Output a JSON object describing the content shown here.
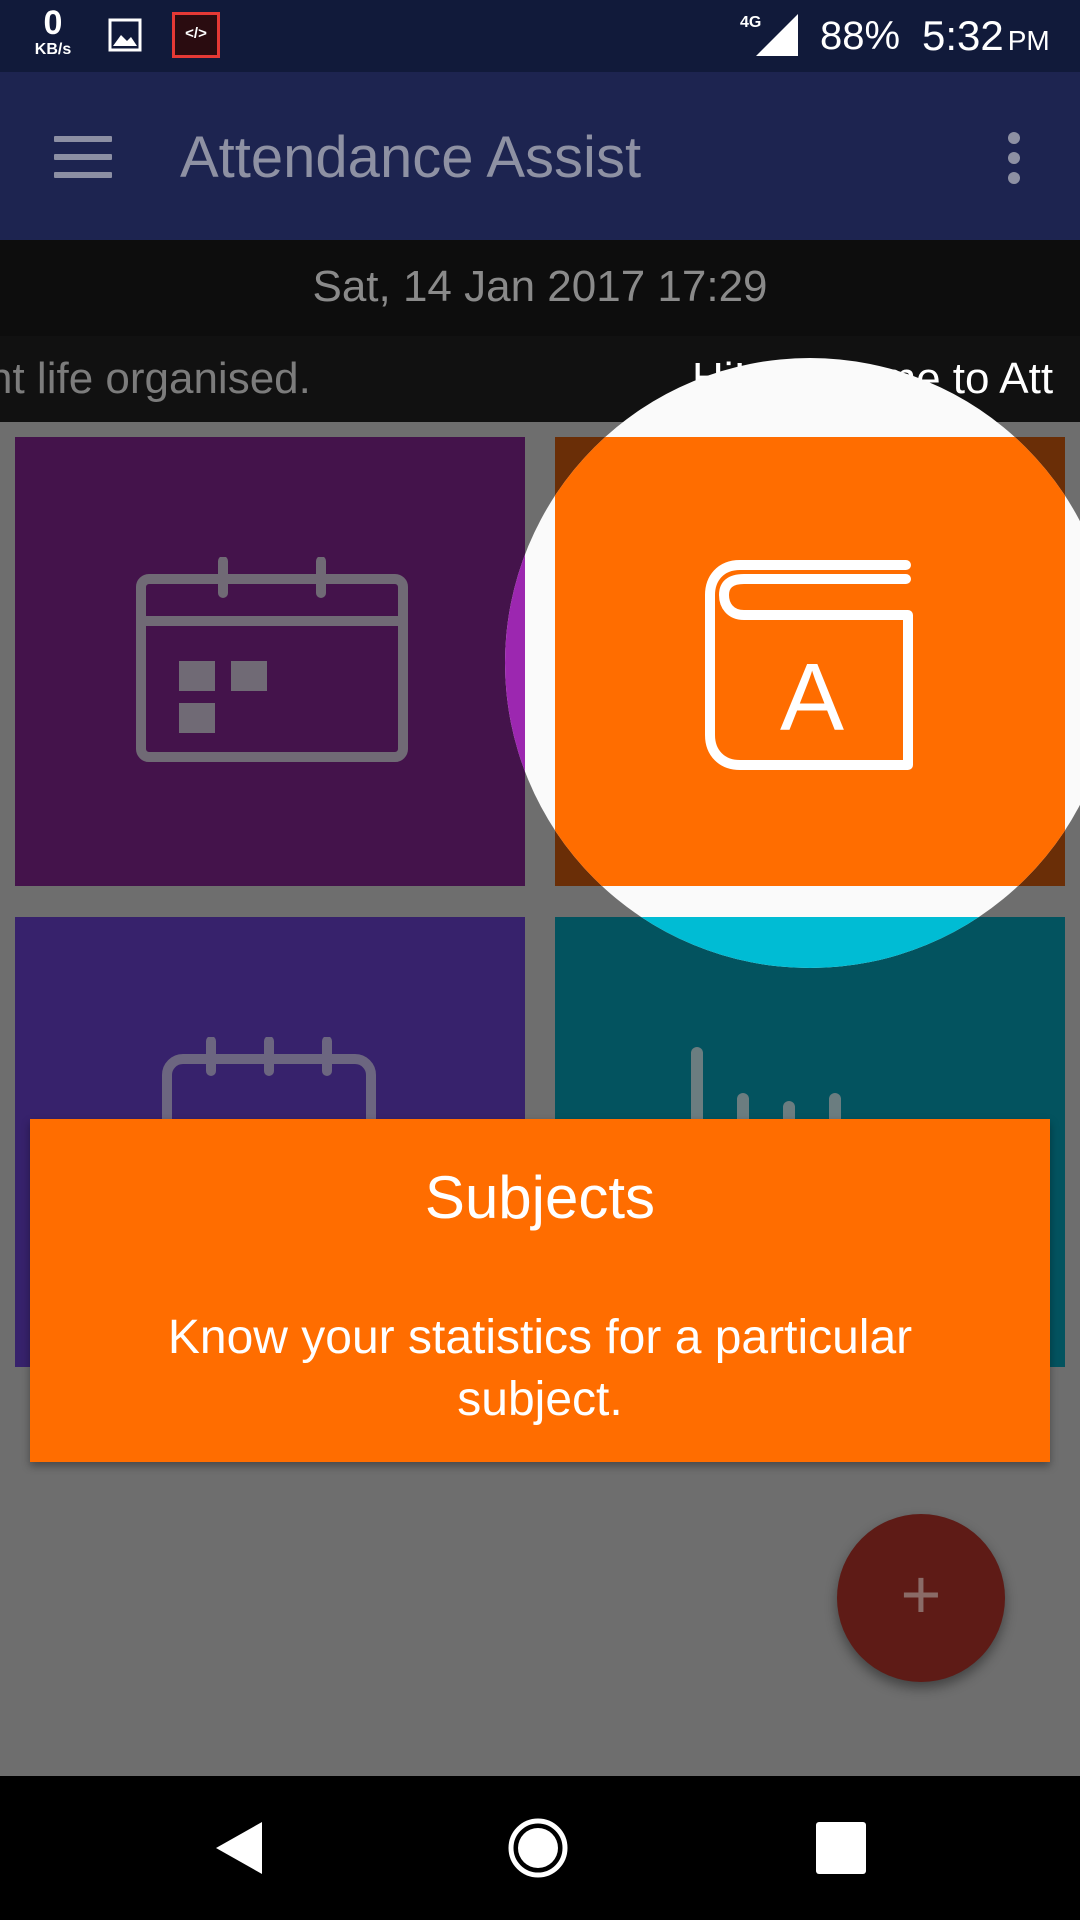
{
  "status_bar": {
    "speed_value": "0",
    "speed_unit": "KB/s",
    "dev_badge": "</>",
    "network": "4G",
    "battery": "88%",
    "time": "5:32",
    "ampm": "PM",
    "icons": [
      "gallery-icon",
      "code-icon",
      "signal-icon"
    ]
  },
  "toolbar": {
    "title": "Attendance Assist",
    "menu_icon": "hamburger-menu-icon",
    "overflow_icon": "more-vert-icon"
  },
  "datetime": "Sat, 14 Jan 2017 17:29",
  "marquee": {
    "left_text": "nt life organised.",
    "right_text": "Hi! Welcome to Att"
  },
  "tiles": [
    {
      "name": "attendance",
      "icon": "calendar-icon",
      "color": "#44134b"
    },
    {
      "name": "subjects",
      "icon": "book-a-icon",
      "color": "#ff6d00"
    },
    {
      "name": "timetable",
      "icon": "calendar-week-icon",
      "color": "#37226c"
    },
    {
      "name": "statistics",
      "icon": "bar-chart-icon",
      "color": "#03535f"
    }
  ],
  "tooltip": {
    "title": "Subjects",
    "description": "Know your statistics for a particular subject."
  },
  "fab": {
    "label": "+",
    "icon": "add-icon",
    "color": "#5e1b16"
  },
  "nav_bar": {
    "icons": [
      "back-icon",
      "home-icon",
      "recents-icon"
    ]
  },
  "colors": {
    "accent": "#ff6d00",
    "primary": "#1d2450",
    "spotlight": "#fafafa"
  }
}
